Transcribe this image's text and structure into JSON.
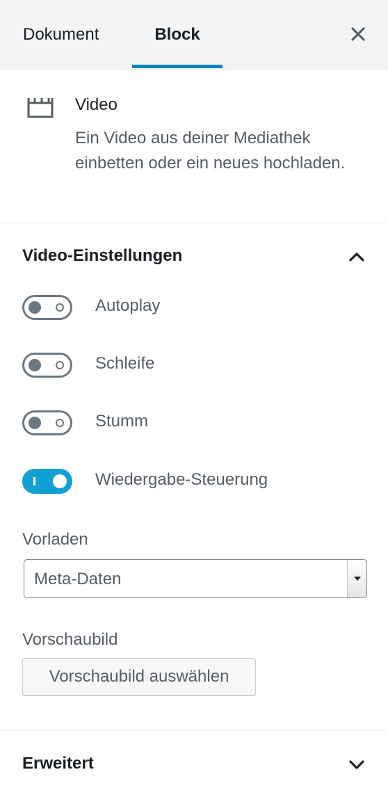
{
  "tabs": {
    "document": "Dokument",
    "block": "Block",
    "active": "Block"
  },
  "block": {
    "icon": "video-clapperboard-icon",
    "title": "Video",
    "description": "Ein Video aus deiner Mediathek einbetten oder ein neues hochladen."
  },
  "settings": {
    "title": "Video-Einstellungen",
    "expanded": true,
    "toggles": [
      {
        "label": "Autoplay",
        "checked": false
      },
      {
        "label": "Schleife",
        "checked": false
      },
      {
        "label": "Stumm",
        "checked": false
      },
      {
        "label": "Wiedergabe-Steuerung",
        "checked": true
      }
    ],
    "preload_label": "Vorladen",
    "preload_value": "Meta-Daten",
    "poster_label": "Vorschaubild",
    "poster_button": "Vorschaubild auswählen"
  },
  "advanced": {
    "title": "Erweitert",
    "expanded": false
  },
  "colors": {
    "accent": "#11a0d2",
    "tab_underline": "#0085ba",
    "text": "#191e23",
    "muted_text": "#555d66",
    "toggle_off": "#6c7781"
  }
}
